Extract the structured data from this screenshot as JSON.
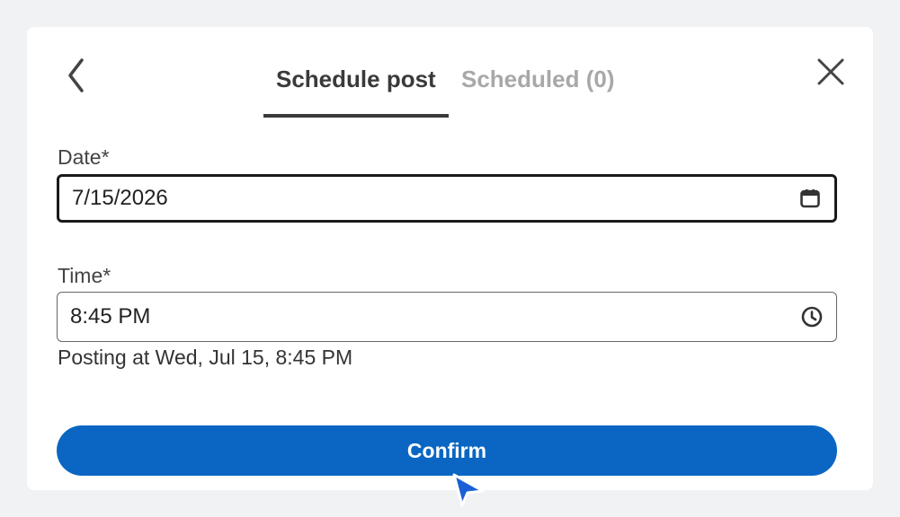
{
  "tabs": [
    {
      "label": "Schedule post",
      "active": true
    },
    {
      "label": "Scheduled (0)",
      "active": false
    }
  ],
  "date": {
    "label": "Date*",
    "value": "7/15/2026",
    "icon": "calendar-icon"
  },
  "time": {
    "label": "Time*",
    "value": "8:45 PM",
    "icon": "clock-icon"
  },
  "helper_text": "Posting at Wed, Jul 15, 8:45 PM",
  "confirm_label": "Confirm",
  "icons": {
    "back": "chevron-left-icon",
    "close": "close-icon",
    "cursor": "mouse-pointer-icon"
  },
  "colors": {
    "accent": "#0a66c2",
    "active_tab": "#3a3a3a",
    "inactive_tab": "#a8a8a8"
  }
}
